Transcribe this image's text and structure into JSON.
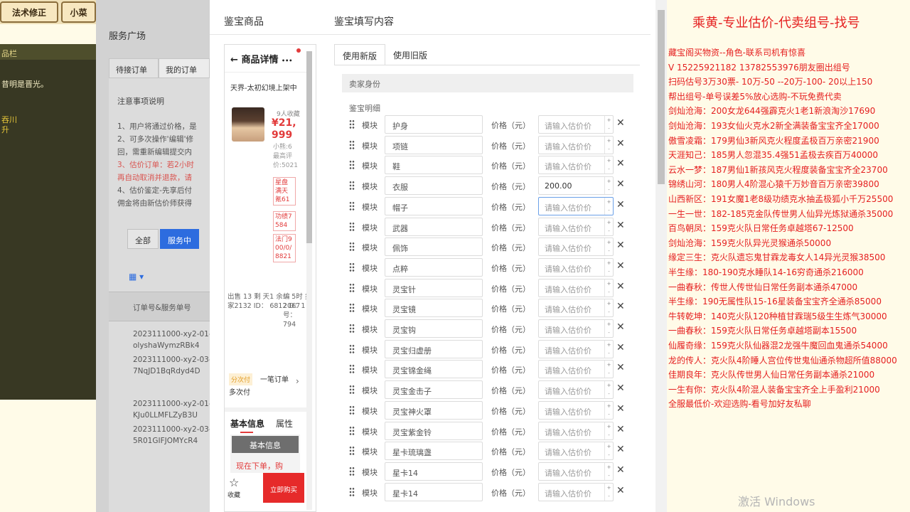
{
  "game": {
    "tab1": "法术修正",
    "tab2": "小菜",
    "strip_label": "品栏",
    "line1": "昔明是晋光。",
    "line2": "吞川",
    "line3": "升"
  },
  "bg": {
    "title": "服务广场",
    "tabs": [
      "待接订单",
      "我的订单"
    ],
    "notes_title": "注意事项说明",
    "notes": [
      "1、用户将通过价格，是",
      "2、可多次操作'编辑'修",
      "回，需重新编辑提交内",
      "3、估价订单：若2小时",
      "再自动取消并退款，请",
      "4、估价鉴定-先享后付",
      "佣金将由新估价师获得"
    ],
    "btn_all": "全部",
    "btn_serving": "服务中",
    "grid_icon": "grid-icon",
    "table_head": "订单号&服务单号",
    "orders": [
      "2023111000-xy2-01-",
      "olyshaWymzRBk4",
      "2023111000-xy2-03-",
      "7NqJD1BqRdyd4D",
      "2023111000-xy2-01-",
      "KJu0LLMFLZyB3U",
      "2023111000-xy2-03-",
      "5R01GIFJOMYcR4"
    ]
  },
  "modal": {
    "left_title": "鉴宝商品",
    "right_title": "鉴宝填写内容",
    "close_icon": "close-icon"
  },
  "phone": {
    "title": "商品详情",
    "more": "•••",
    "subtitle": "天界-太初幻境上架中",
    "fav_count": "9人收藏",
    "price": "¥21,999",
    "lines": [
      "小熊:6",
      "最高评",
      "价:5021"
    ],
    "tags": [
      "星盘满天氪61",
      "功绩7584",
      "法门900/0/8821"
    ],
    "stats": "出售 13  剩  天1  余：  5时  卖家2132  ID：  6812  D：1",
    "stats_right": "编 2067 号：  794",
    "badge": "分次付",
    "pay_line1": "一笔订单",
    "pay_line2": "多次付",
    "tab_basic": "基本信息",
    "tab_attr": "属性",
    "card_head": "基本信息",
    "card_text": "现在下单，购",
    "fav_label": "收藏",
    "buy_label": "立即购买"
  },
  "form": {
    "tab_new": "使用新版",
    "tab_old": "使用旧版",
    "seller_label": "卖家身份",
    "detail_label": "鉴宝明细",
    "module_label": "模块",
    "price_label": "价格（元）",
    "price_placeholder": "请输入估价价",
    "rows": [
      {
        "name": "护身",
        "value": ""
      },
      {
        "name": "项链",
        "value": ""
      },
      {
        "name": "鞋",
        "value": ""
      },
      {
        "name": "衣服",
        "value": "200.00"
      },
      {
        "name": "帽子",
        "value": ""
      },
      {
        "name": "武器",
        "value": ""
      },
      {
        "name": "佩饰",
        "value": ""
      },
      {
        "name": "点粹",
        "value": ""
      },
      {
        "name": "灵宝针",
        "value": ""
      },
      {
        "name": "灵宝镜",
        "value": ""
      },
      {
        "name": "灵宝钩",
        "value": ""
      },
      {
        "name": "灵宝归虚册",
        "value": ""
      },
      {
        "name": "灵宝锦金绳",
        "value": ""
      },
      {
        "name": "灵宝金击子",
        "value": ""
      },
      {
        "name": "灵宝神火罩",
        "value": ""
      },
      {
        "name": "灵宝紫金铃",
        "value": ""
      },
      {
        "name": "星卡琉璃盏",
        "value": ""
      },
      {
        "name": "星卡14",
        "value": ""
      },
      {
        "name": "星卡14",
        "value": ""
      }
    ]
  },
  "overlay": {
    "title": "乘黄-专业估价-代卖组号-找号",
    "lines": [
      "藏宝阁买物资--角色-联系司机有惊喜",
      "V 15225921182  13782553976朋友圈出组号",
      "扫码估号3万30票- 10万-50 --20万-100- 20以上150",
      "帮出组号-单号误差5%放心选购-不玩免费代卖",
      "剑灿沧海：200女龙644强霹克火1老1新浪淘沙17690",
      "剑灿沧海：193女仙火克水2新全满装备宝宝齐全17000",
      "傲雪凌霜：179男仙3新风克火程度孟极百万亲密21900",
      "天涯知己：185男人忽混35.4强51孟极去疾百万40000",
      "云水一梦：187男仙1新孩风克火程度装备宝宝齐全23700",
      "锦绣山河：180男人4阶混心猿千万妙音百万亲密39800",
      "山西新区：191女魔1老8级功绩克水抽孟极狐小千万25500",
      "一生一世：182-185克金队传世男人仙异光炼狱通杀35000",
      "百鸟朝凤：159克火队日常任务卓越塔67-12500",
      "剑灿沧海：159克火队异光灵猴通杀50000",
      "缘定三生：克火队遗忘鬼甘霖龙毒女人14异光灵猴38500",
      "半生缘：180-190克水睡队14-16穷奇通杀216000",
      "一曲春秋：传世人传世仙日常任务副本通杀47000",
      "半生缘：190无属性队15-16星装备宝宝齐全通杀85000",
      "牛转乾坤：140克火队120种植甘霖瑞5级生生炼气30000",
      "一曲春秋：159克火队日常任务卓越塔副本15500",
      "仙履奇缘：159克火队仙器混2龙强牛魔回血鬼通杀54000",
      "龙的传人：克火队4阶睡人宫位传世鬼仙通杀物超所值88000",
      "佳期良年：克火队传世男人仙日常任务副本通杀21000",
      "一生有你：克火队4阶混人装备宝宝齐全上手盈利21000",
      "全服最低价-欢迎选购-看号加好友私聊"
    ],
    "watermark": "激活 Windows"
  }
}
